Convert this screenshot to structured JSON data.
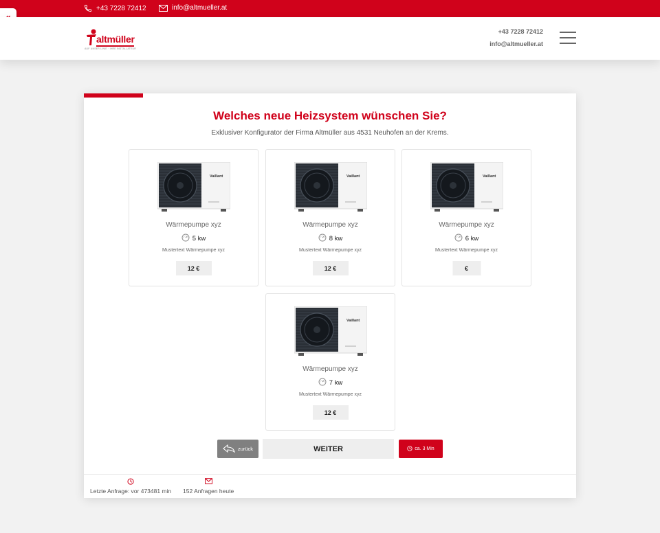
{
  "topbar": {
    "phone": "+43 7228 72412",
    "email": "info@altmueller.at"
  },
  "header": {
    "logo_text": "altmüller",
    "logo_tagline": "AUF UNSER LINIE · IHRE INSTALLATEUR",
    "phone": "+43 7228 72412",
    "email": "info@altmueller.at"
  },
  "configurator": {
    "title": "Welches neue Heizsystem wünschen Sie?",
    "subtitle": "Exklusiver Konfigurator der Firma Altmüller aus 4531 Neuhofen an der Krems.",
    "pump_brand": "Vaillant",
    "options": [
      {
        "name": "Wärmepumpe xyz",
        "power": "5 kw",
        "description": "Mustertext Wärmepumpe xyz",
        "price": "12 €"
      },
      {
        "name": "Wärmepumpe xyz",
        "power": "8 kw",
        "description": "Mustertext Wärmepumpe xyz",
        "price": "12 €"
      },
      {
        "name": "Wärmepumpe xyz",
        "power": "6 kw",
        "description": "Mustertext Wärmepumpe xyz",
        "price": "€"
      },
      {
        "name": "Wärmepumpe xyz",
        "power": "7 kw",
        "description": "Mustertext Wärmepumpe xyz",
        "price": "12 €"
      }
    ],
    "back_label": "zurück",
    "next_label": "WEITER",
    "time_label": "ca. 3 Min"
  },
  "stats": {
    "last_request": "Letzte Anfrage: vor 473481 min",
    "requests_today": "152 Anfragen heute"
  },
  "colors": {
    "brand_red": "#d0021b",
    "button_grey": "#808080",
    "light_grey": "#eeeeee"
  }
}
